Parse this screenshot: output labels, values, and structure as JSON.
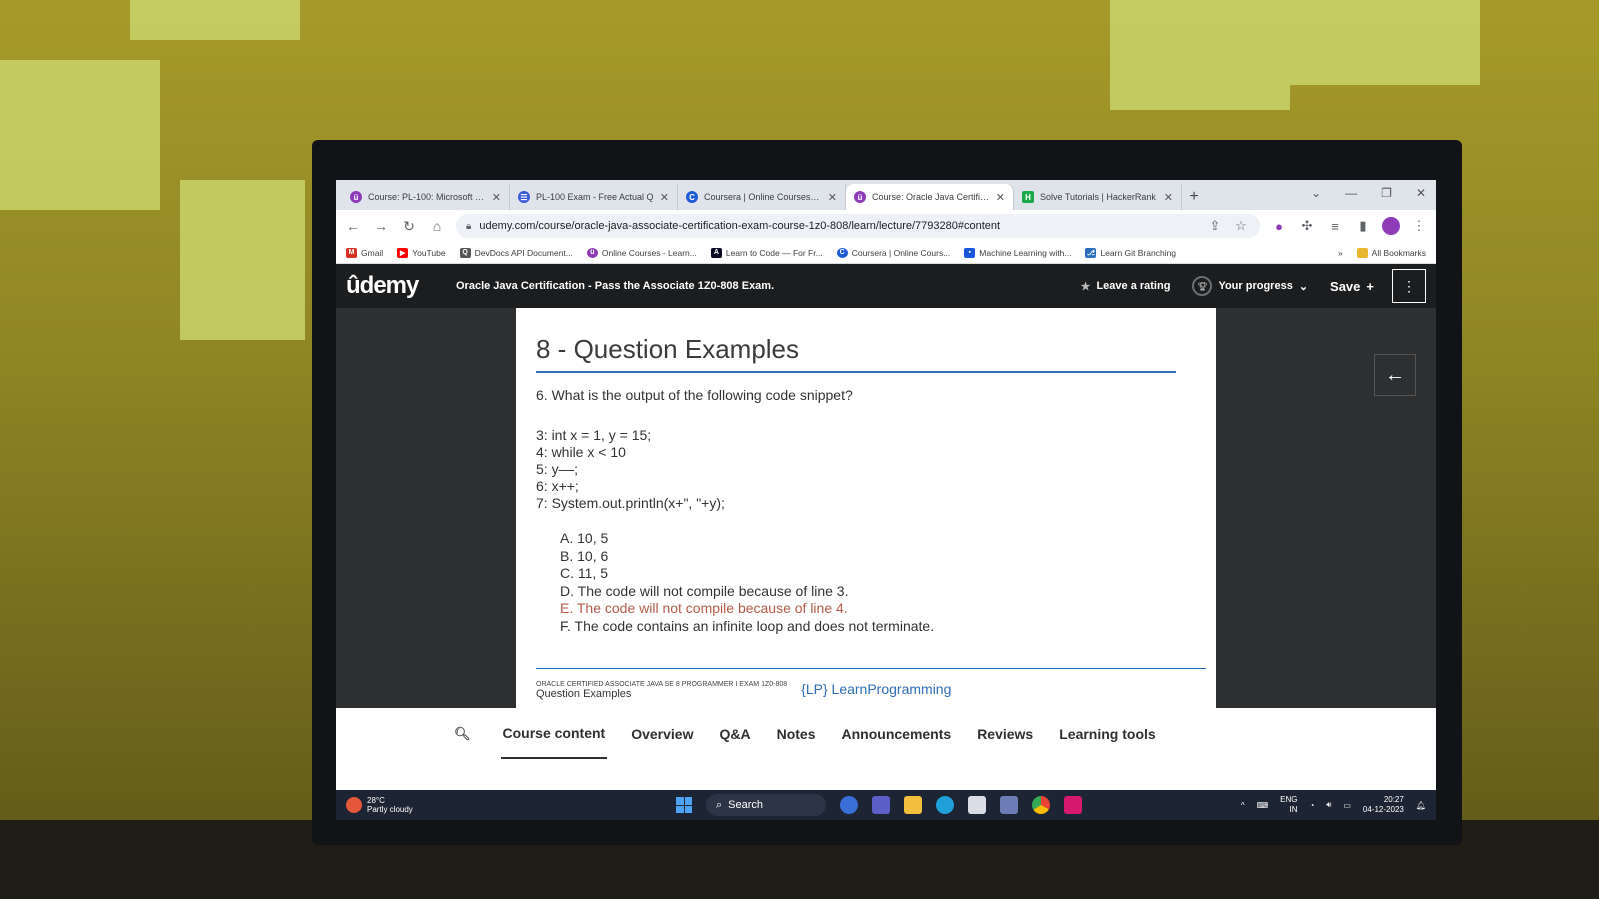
{
  "browser": {
    "tabs": [
      {
        "label": "Course: PL-100: Microsoft Po",
        "favicon_color": "#8e3bb8",
        "active": false
      },
      {
        "label": "PL-100 Exam - Free Actual Q",
        "favicon_color": "#3b5bd6",
        "active": false
      },
      {
        "label": "Coursera | Online Courses Fro",
        "favicon_color": "#1f5bd6",
        "active": false
      },
      {
        "label": "Course: Oracle Java Certificat",
        "favicon_color": "#8e3bb8",
        "active": true
      },
      {
        "label": "Solve Tutorials | HackerRank",
        "favicon_color": "#1ba94c",
        "active": false
      }
    ],
    "new_tab": "+",
    "url": "udemy.com/course/oracle-java-associate-certification-exam-course-1z0-808/learn/lecture/7793280#content",
    "bookmarks": [
      {
        "label": "Gmail",
        "color": "#d93025"
      },
      {
        "label": "YouTube",
        "color": "#ff0000"
      },
      {
        "label": "DevDocs API Document...",
        "color": "#555555"
      },
      {
        "label": "Online Courses - Learn...",
        "color": "#8e3bb8"
      },
      {
        "label": "Learn to Code — For Fr...",
        "color": "#0a0a23"
      },
      {
        "label": "Coursera | Online Cours...",
        "color": "#1f5bd6"
      },
      {
        "label": "Machine Learning with...",
        "color": "#1a56db"
      },
      {
        "label": "Learn Git Branching",
        "color": "#2a6ebd"
      }
    ],
    "all_bookmarks": "All Bookmarks"
  },
  "udemy": {
    "logo": "ûdemy",
    "course_title": "Oracle Java Certification - Pass the Associate 1Z0-808 Exam.",
    "leave_rating": "Leave a rating",
    "your_progress": "Your progress",
    "save": "Save",
    "save_plus": "+"
  },
  "slide": {
    "title": "8 - Question Examples",
    "question": "6.  What is the output of the following code snippet?",
    "code": [
      "3: int x = 1, y = 15;",
      "4: while x < 10",
      "5: y––;",
      "6: x++;",
      "7: System.out.println(x+\", \"+y);"
    ],
    "options": [
      "A. 10, 5",
      "B. 10, 6",
      "C. 11, 5",
      "D. The code will not compile because of line 3.",
      "E. The code will not compile because of line 4.",
      "F. The code contains an infinite loop and does not terminate."
    ],
    "footer_line1": "ORACLE CERTIFIED ASSOCIATE JAVA SE 8 PROGRAMMER I EXAM 1Z0-808",
    "footer_line2": "Question Examples",
    "footer_logo": "{LP} LearnProgramming"
  },
  "course_tabs": [
    "Course content",
    "Overview",
    "Q&A",
    "Notes",
    "Announcements",
    "Reviews",
    "Learning tools"
  ],
  "taskbar": {
    "temperature": "28°C",
    "weather": "Partly cloudy",
    "search": "Search",
    "lang": "ENG",
    "region": "IN",
    "time": "20:27",
    "date": "04-12-2023"
  }
}
